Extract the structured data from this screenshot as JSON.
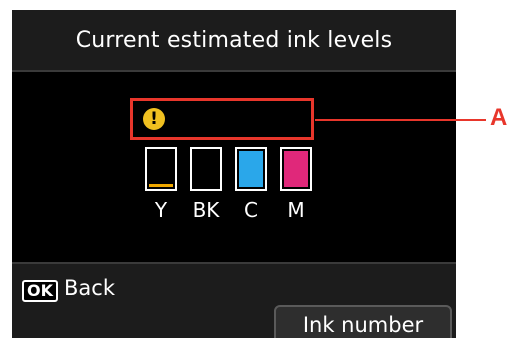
{
  "screen": {
    "title": "Current estimated ink levels",
    "warning": {
      "icon": "exclamation-icon",
      "icon_glyph": "!"
    },
    "tanks": [
      {
        "label": "Y",
        "color": "#f0a800",
        "level": 0.05
      },
      {
        "label": "BK",
        "color": "#000000",
        "level": 0.0
      },
      {
        "label": "C",
        "color": "#2aa7ea",
        "level": 1.0
      },
      {
        "label": "M",
        "color": "#e0287a",
        "level": 1.0
      }
    ],
    "footer": {
      "ok_key": "OK",
      "back_label": "Back",
      "ink_number_label": "Ink number"
    }
  },
  "callout": {
    "label": "A",
    "color": "#e8362b"
  }
}
